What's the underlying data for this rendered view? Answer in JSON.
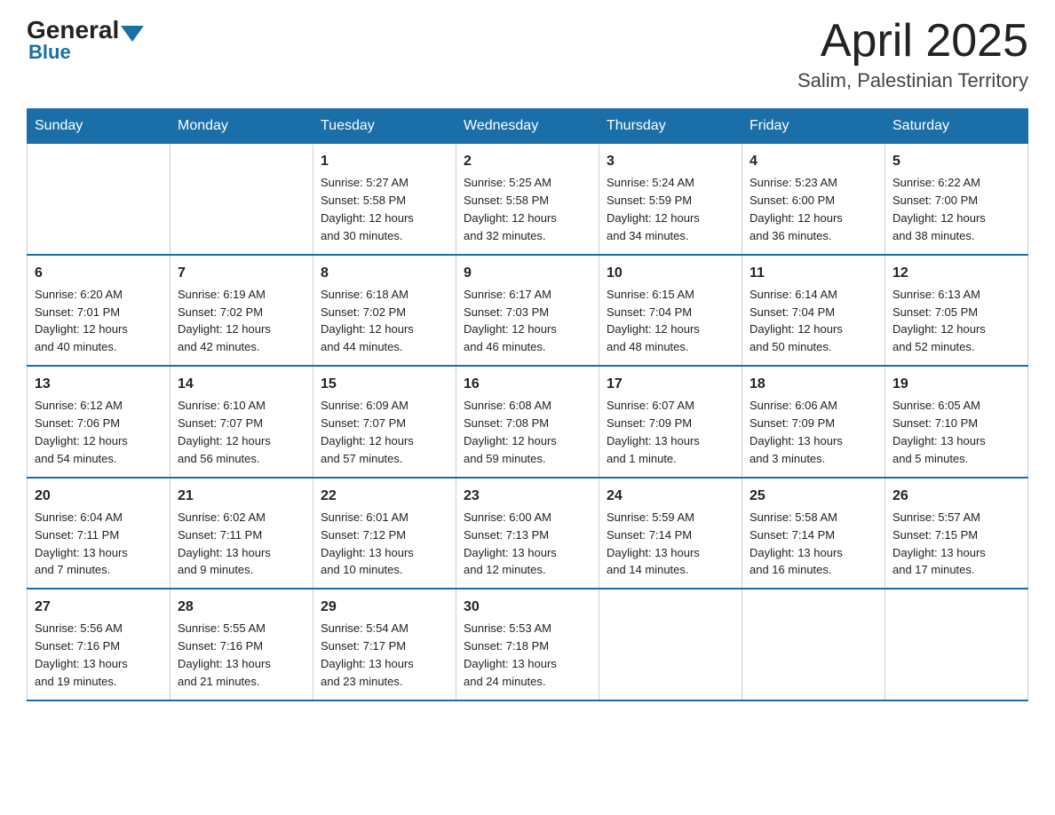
{
  "header": {
    "logo_general": "General",
    "logo_blue": "Blue",
    "title": "April 2025",
    "subtitle": "Salim, Palestinian Territory"
  },
  "days_of_week": [
    "Sunday",
    "Monday",
    "Tuesday",
    "Wednesday",
    "Thursday",
    "Friday",
    "Saturday"
  ],
  "weeks": [
    [
      {
        "day": "",
        "info": ""
      },
      {
        "day": "",
        "info": ""
      },
      {
        "day": "1",
        "info": "Sunrise: 5:27 AM\nSunset: 5:58 PM\nDaylight: 12 hours\nand 30 minutes."
      },
      {
        "day": "2",
        "info": "Sunrise: 5:25 AM\nSunset: 5:58 PM\nDaylight: 12 hours\nand 32 minutes."
      },
      {
        "day": "3",
        "info": "Sunrise: 5:24 AM\nSunset: 5:59 PM\nDaylight: 12 hours\nand 34 minutes."
      },
      {
        "day": "4",
        "info": "Sunrise: 5:23 AM\nSunset: 6:00 PM\nDaylight: 12 hours\nand 36 minutes."
      },
      {
        "day": "5",
        "info": "Sunrise: 6:22 AM\nSunset: 7:00 PM\nDaylight: 12 hours\nand 38 minutes."
      }
    ],
    [
      {
        "day": "6",
        "info": "Sunrise: 6:20 AM\nSunset: 7:01 PM\nDaylight: 12 hours\nand 40 minutes."
      },
      {
        "day": "7",
        "info": "Sunrise: 6:19 AM\nSunset: 7:02 PM\nDaylight: 12 hours\nand 42 minutes."
      },
      {
        "day": "8",
        "info": "Sunrise: 6:18 AM\nSunset: 7:02 PM\nDaylight: 12 hours\nand 44 minutes."
      },
      {
        "day": "9",
        "info": "Sunrise: 6:17 AM\nSunset: 7:03 PM\nDaylight: 12 hours\nand 46 minutes."
      },
      {
        "day": "10",
        "info": "Sunrise: 6:15 AM\nSunset: 7:04 PM\nDaylight: 12 hours\nand 48 minutes."
      },
      {
        "day": "11",
        "info": "Sunrise: 6:14 AM\nSunset: 7:04 PM\nDaylight: 12 hours\nand 50 minutes."
      },
      {
        "day": "12",
        "info": "Sunrise: 6:13 AM\nSunset: 7:05 PM\nDaylight: 12 hours\nand 52 minutes."
      }
    ],
    [
      {
        "day": "13",
        "info": "Sunrise: 6:12 AM\nSunset: 7:06 PM\nDaylight: 12 hours\nand 54 minutes."
      },
      {
        "day": "14",
        "info": "Sunrise: 6:10 AM\nSunset: 7:07 PM\nDaylight: 12 hours\nand 56 minutes."
      },
      {
        "day": "15",
        "info": "Sunrise: 6:09 AM\nSunset: 7:07 PM\nDaylight: 12 hours\nand 57 minutes."
      },
      {
        "day": "16",
        "info": "Sunrise: 6:08 AM\nSunset: 7:08 PM\nDaylight: 12 hours\nand 59 minutes."
      },
      {
        "day": "17",
        "info": "Sunrise: 6:07 AM\nSunset: 7:09 PM\nDaylight: 13 hours\nand 1 minute."
      },
      {
        "day": "18",
        "info": "Sunrise: 6:06 AM\nSunset: 7:09 PM\nDaylight: 13 hours\nand 3 minutes."
      },
      {
        "day": "19",
        "info": "Sunrise: 6:05 AM\nSunset: 7:10 PM\nDaylight: 13 hours\nand 5 minutes."
      }
    ],
    [
      {
        "day": "20",
        "info": "Sunrise: 6:04 AM\nSunset: 7:11 PM\nDaylight: 13 hours\nand 7 minutes."
      },
      {
        "day": "21",
        "info": "Sunrise: 6:02 AM\nSunset: 7:11 PM\nDaylight: 13 hours\nand 9 minutes."
      },
      {
        "day": "22",
        "info": "Sunrise: 6:01 AM\nSunset: 7:12 PM\nDaylight: 13 hours\nand 10 minutes."
      },
      {
        "day": "23",
        "info": "Sunrise: 6:00 AM\nSunset: 7:13 PM\nDaylight: 13 hours\nand 12 minutes."
      },
      {
        "day": "24",
        "info": "Sunrise: 5:59 AM\nSunset: 7:14 PM\nDaylight: 13 hours\nand 14 minutes."
      },
      {
        "day": "25",
        "info": "Sunrise: 5:58 AM\nSunset: 7:14 PM\nDaylight: 13 hours\nand 16 minutes."
      },
      {
        "day": "26",
        "info": "Sunrise: 5:57 AM\nSunset: 7:15 PM\nDaylight: 13 hours\nand 17 minutes."
      }
    ],
    [
      {
        "day": "27",
        "info": "Sunrise: 5:56 AM\nSunset: 7:16 PM\nDaylight: 13 hours\nand 19 minutes."
      },
      {
        "day": "28",
        "info": "Sunrise: 5:55 AM\nSunset: 7:16 PM\nDaylight: 13 hours\nand 21 minutes."
      },
      {
        "day": "29",
        "info": "Sunrise: 5:54 AM\nSunset: 7:17 PM\nDaylight: 13 hours\nand 23 minutes."
      },
      {
        "day": "30",
        "info": "Sunrise: 5:53 AM\nSunset: 7:18 PM\nDaylight: 13 hours\nand 24 minutes."
      },
      {
        "day": "",
        "info": ""
      },
      {
        "day": "",
        "info": ""
      },
      {
        "day": "",
        "info": ""
      }
    ]
  ]
}
